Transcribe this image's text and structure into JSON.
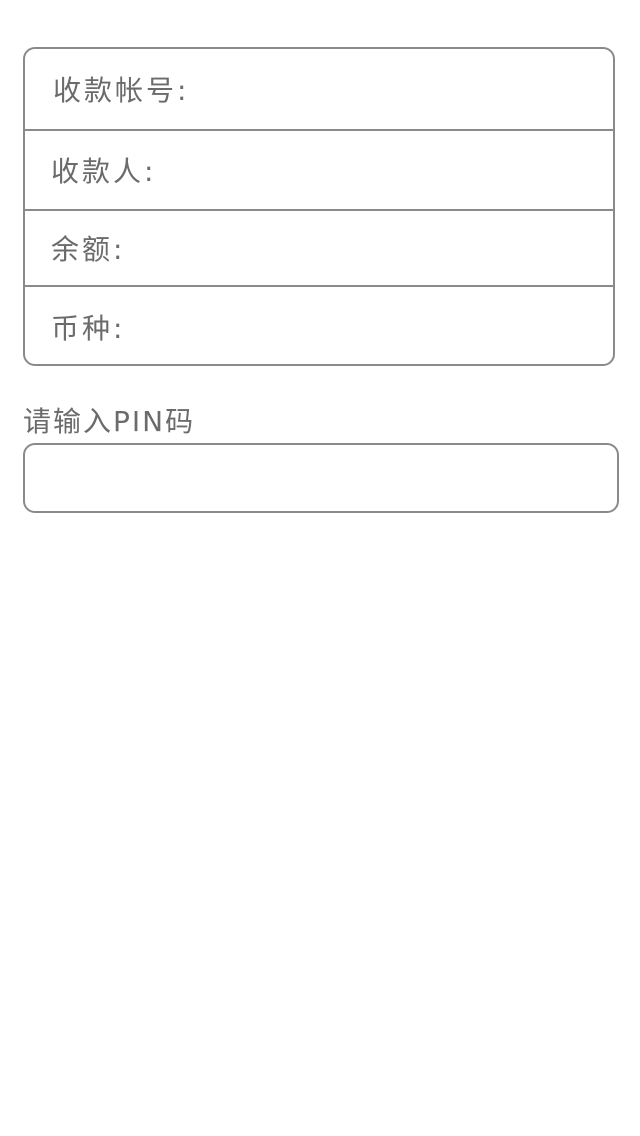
{
  "info_card": {
    "rows": [
      {
        "label": "收款帐号:"
      },
      {
        "label": "收款人:"
      },
      {
        "label": "余额:"
      },
      {
        "label": "币种:"
      }
    ]
  },
  "pin": {
    "label": "请输入PIN码",
    "value": "",
    "placeholder": ""
  }
}
